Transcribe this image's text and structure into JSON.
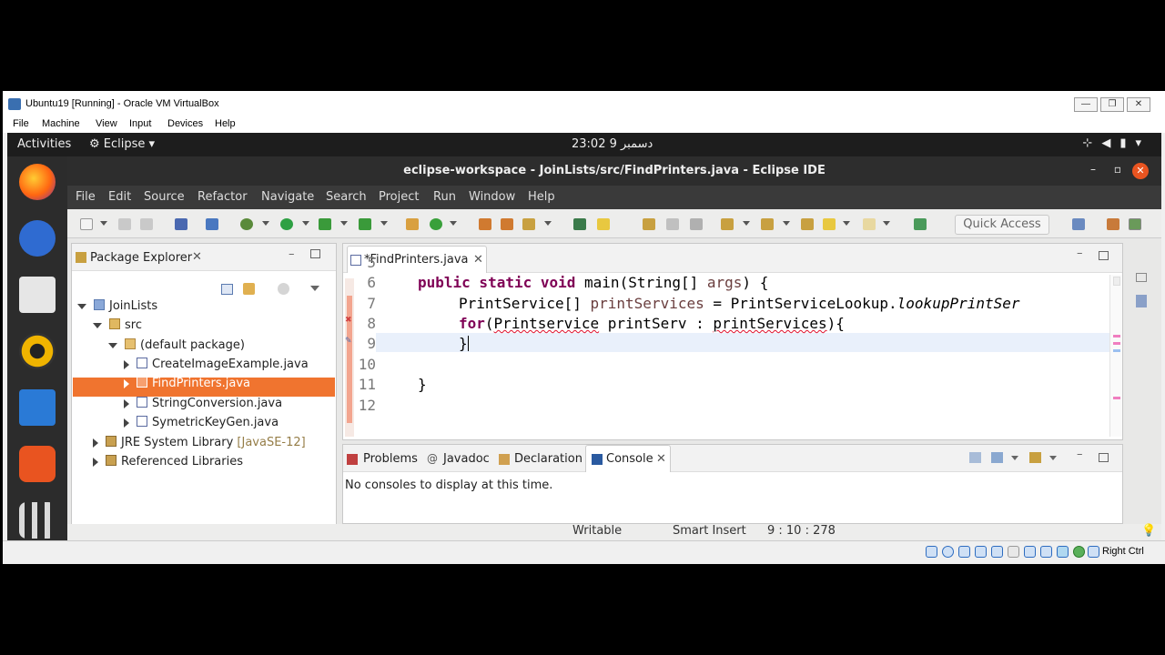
{
  "vbox": {
    "title": "Ubuntu19 [Running] - Oracle VM VirtualBox",
    "menu": [
      "File",
      "Machine",
      "View",
      "Input",
      "Devices",
      "Help"
    ],
    "host_key": "Right Ctrl"
  },
  "gnome": {
    "activities": "Activities",
    "app": "Eclipse ▾",
    "clock": "23:02  9 دسمبر"
  },
  "eclipse": {
    "title": "eclipse-workspace - JoinLists/src/FindPrinters.java - Eclipse IDE",
    "menu": [
      "File",
      "Edit",
      "Source",
      "Refactor",
      "Navigate",
      "Search",
      "Project",
      "Run",
      "Window",
      "Help"
    ],
    "quick_access": "Quick Access"
  },
  "package_explorer": {
    "title": "Package Explorer",
    "tree": [
      "JoinLists",
      "src",
      "(default package)",
      "CreateImageExample.java",
      "FindPrinters.java",
      "StringConversion.java",
      "SymetricKeyGen.java",
      "JRE System Library",
      "[JavaSE-12]",
      "Referenced Libraries"
    ]
  },
  "editor": {
    "tab": "*FindPrinters.java",
    "line_numbers": [
      "5",
      "6",
      "7",
      "8",
      "9",
      "10",
      "11",
      "12"
    ],
    "code": {
      "l6_a": "public static void ",
      "l6_b": "main(String[] ",
      "l6_c": "args",
      "l6_d": ") {",
      "l7_a": "PrintService[] ",
      "l7_b": "printServices",
      "l7_c": " = PrintServiceLookup.",
      "l7_d": "lookupPrintSer",
      "l8_a": "for",
      "l8_b": "(",
      "l8_c": "Printservice",
      "l8_d": " printServ : ",
      "l8_e": "printServices",
      "l8_f": "){",
      "l9": "}",
      "l11": "}"
    }
  },
  "console": {
    "tabs": [
      "Problems",
      "Javadoc",
      "Declaration",
      "Console"
    ],
    "message": "No consoles to display at this time."
  },
  "status": {
    "writable": "Writable",
    "insert": "Smart Insert",
    "position": "9 : 10 : 278"
  }
}
